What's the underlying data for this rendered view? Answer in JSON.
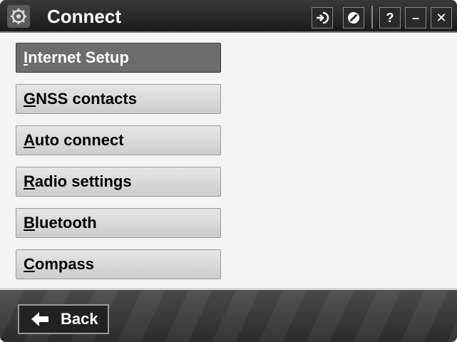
{
  "window": {
    "title": "Connect",
    "app_icon": "gear-satellite-icon",
    "title_buttons": [
      {
        "name": "login-icon"
      },
      {
        "name": "no-entry-icon"
      },
      {
        "name": "help-button",
        "label": "?"
      },
      {
        "name": "minimize-button",
        "label": "–"
      },
      {
        "name": "close-button",
        "label": "✕"
      }
    ]
  },
  "menu": {
    "items": [
      {
        "accel": "I",
        "rest": "nternet Setup",
        "selected": true
      },
      {
        "accel": "G",
        "rest": "NSS contacts",
        "selected": false
      },
      {
        "accel": "A",
        "rest": "uto connect",
        "selected": false
      },
      {
        "accel": "R",
        "rest": "adio settings",
        "selected": false
      },
      {
        "accel": "B",
        "rest": "luetooth",
        "selected": false
      },
      {
        "accel": "C",
        "rest": "ompass",
        "selected": false
      }
    ]
  },
  "footer": {
    "back_label": "Back",
    "back_icon": "arrow-left-icon"
  },
  "colors": {
    "titlebar": "#2a2a2a",
    "content_bg": "#f4f4f4",
    "selected_bg": "#6c6c6c",
    "button_bg": "#d6d6d6"
  }
}
